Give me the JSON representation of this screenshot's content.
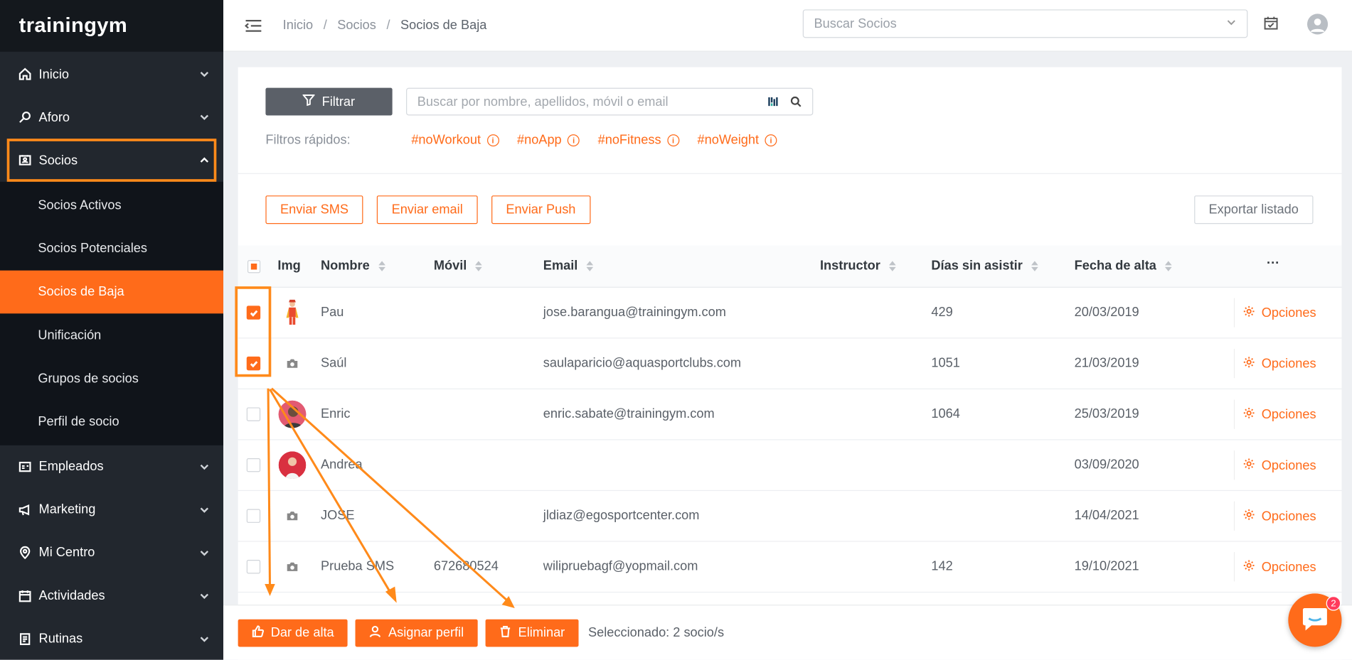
{
  "app": {
    "logo": "trainingym"
  },
  "sidebar": {
    "items": [
      {
        "label": "Inicio",
        "icon": "home-icon"
      },
      {
        "label": "Aforo",
        "icon": "search-icon"
      },
      {
        "label": "Socios",
        "icon": "contact-card-icon"
      },
      {
        "label": "Empleados",
        "icon": "id-card-icon"
      },
      {
        "label": "Marketing",
        "icon": "megaphone-icon"
      },
      {
        "label": "Mi Centro",
        "icon": "location-pin-icon"
      },
      {
        "label": "Actividades",
        "icon": "calendar-icon"
      },
      {
        "label": "Rutinas",
        "icon": "clipboard-icon"
      }
    ],
    "socios_sub": [
      {
        "label": "Socios Activos"
      },
      {
        "label": "Socios Potenciales"
      },
      {
        "label": "Socios de Baja"
      },
      {
        "label": "Unificación"
      },
      {
        "label": "Grupos de socios"
      },
      {
        "label": "Perfil de socio"
      }
    ]
  },
  "header": {
    "breadcrumb": [
      "Inicio",
      "Socios",
      "Socios de Baja"
    ],
    "search_placeholder": "Buscar Socios"
  },
  "filters": {
    "filter_button": "Filtrar",
    "search_placeholder": "Buscar por nombre, apellidos, móvil o email",
    "quick_label": "Filtros rápidos:",
    "quick_tags": [
      "#noWorkout",
      "#noApp",
      "#noFitness",
      "#noWeight"
    ]
  },
  "actions": {
    "sms": "Enviar SMS",
    "email": "Enviar email",
    "push": "Enviar Push",
    "export": "Exportar listado"
  },
  "table": {
    "headers": [
      "Img",
      "Nombre",
      "Móvil",
      "Email",
      "Instructor",
      "Días sin asistir",
      "Fecha de alta",
      "···"
    ],
    "options_label": "Opciones",
    "rows": [
      {
        "checked": true,
        "img": "superhero-avatar",
        "nombre": "Pau",
        "movil": "",
        "email": "jose.barangua@trainingym.com",
        "instructor": "",
        "dias": "429",
        "fecha": "20/03/2019"
      },
      {
        "checked": true,
        "img": "camera-icon",
        "nombre": "Saúl",
        "movil": "",
        "email": "saulaparicio@aquasportclubs.com",
        "instructor": "",
        "dias": "1051",
        "fecha": "21/03/2019"
      },
      {
        "checked": false,
        "img": "photo-avatar",
        "nombre": "Enric",
        "movil": "",
        "email": "enric.sabate@trainingym.com",
        "instructor": "",
        "dias": "1064",
        "fecha": "25/03/2019"
      },
      {
        "checked": false,
        "img": "photo-avatar",
        "nombre": "Andrea",
        "movil": "",
        "email": "",
        "instructor": "",
        "dias": "",
        "fecha": "03/09/2020"
      },
      {
        "checked": false,
        "img": "camera-icon",
        "nombre": "JOSE",
        "movil": "",
        "email": "jldiaz@egosportcenter.com",
        "instructor": "",
        "dias": "",
        "fecha": "14/04/2021"
      },
      {
        "checked": false,
        "img": "camera-icon",
        "nombre": "Prueba SMS",
        "movil": "672680524",
        "email": "wilipruebagf@yopmail.com",
        "instructor": "",
        "dias": "142",
        "fecha": "19/10/2021"
      }
    ]
  },
  "bottom": {
    "dar_alta": "Dar de alta",
    "asignar": "Asignar perfil",
    "eliminar": "Eliminar",
    "selected": "Seleccionado: 2 socio/s"
  },
  "chat": {
    "badge": "2"
  },
  "colors": {
    "accent": "#ff6b1a",
    "sidebar": "#22272e",
    "annotation": "#ff8a1a"
  }
}
